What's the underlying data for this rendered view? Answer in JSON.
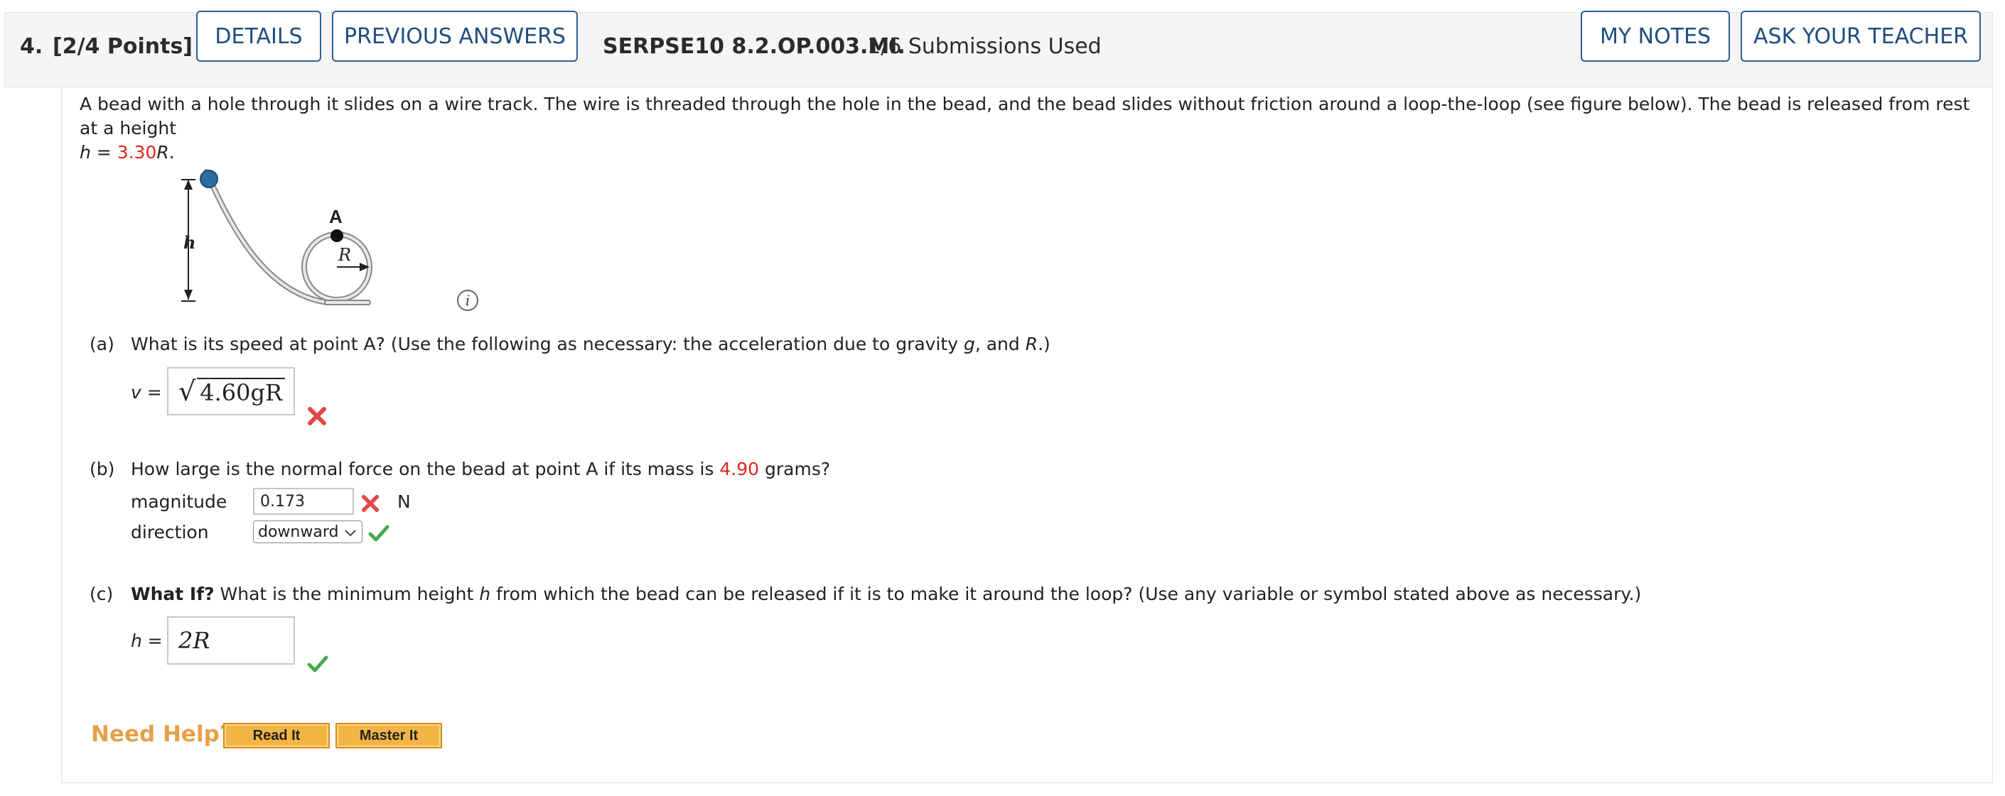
{
  "question": {
    "number": "4.",
    "points": "[2/4 Points]",
    "code": "SERPSE10 8.2.OP.003.MI.",
    "submissions": "1/6 Submissions Used"
  },
  "header_buttons": {
    "details": "DETAILS",
    "previous_answers": "PREVIOUS ANSWERS",
    "my_notes": "MY NOTES",
    "ask_teacher": "ASK YOUR TEACHER"
  },
  "prompt": {
    "text": "A bead with a hole through it slides on a wire track. The wire is threaded through the hole in the bead, and the bead slides without friction around a loop-the-loop (see figure below). The bead is released from rest at a height",
    "h_var": "h",
    "equals": " = ",
    "h_value": "3.30",
    "R_var": "R",
    "period": "."
  },
  "figure": {
    "label_A": "A",
    "label_h": "h",
    "label_R": "R",
    "info_icon_glyph": "i"
  },
  "part_a": {
    "label": "(a)",
    "question_prefix": "What is its speed at point A? (Use the following as necessary: the acceleration due to gravity ",
    "g": "g",
    "question_mid": ", and ",
    "R": "R",
    "question_suffix": ".)",
    "answer_var": "v",
    "answer_eq": " =",
    "answer_value": "4.60gR",
    "status": "incorrect"
  },
  "part_b": {
    "label": "(b)",
    "question_prefix": "How large is the normal force on the bead at point A if its mass is ",
    "mass": "4.90",
    "question_suffix": " grams?",
    "magnitude_label": "magnitude",
    "magnitude_value": "0.173",
    "magnitude_status": "incorrect",
    "unit": "N",
    "direction_label": "direction",
    "direction_value": "downward",
    "direction_status": "correct"
  },
  "part_c": {
    "label": "(c)",
    "what_if": "What If?",
    "question_prefix": " What is the minimum height ",
    "h": "h",
    "question_suffix": " from which the bead can be released if it is to make it around the loop? (Use any variable or symbol stated above as necessary.)",
    "answer_var": "h",
    "answer_eq": " =",
    "answer_value": "2R",
    "status": "correct"
  },
  "help": {
    "title": "Need Help?",
    "read_it": "Read It",
    "master_it": "Master It"
  },
  "colors": {
    "button_border": "#2b5f95",
    "red_value": "#e0261b",
    "incorrect": "#e04848",
    "correct": "#4aa84a",
    "need_help": "#e5a14a",
    "help_button": "#f2b544"
  }
}
